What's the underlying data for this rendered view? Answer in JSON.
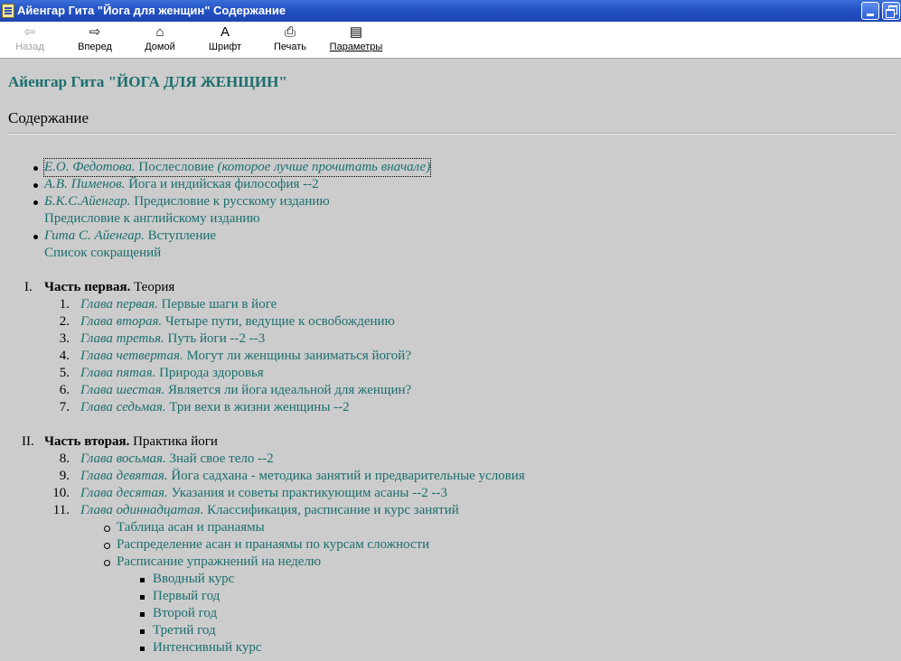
{
  "window": {
    "title": "Айенгар Гита \"Йога для женщин\" Содержание"
  },
  "toolbar": [
    {
      "label": "Назад",
      "icon": "back-arrow-icon",
      "glyph": "⇦",
      "disabled": true
    },
    {
      "label": "Вперед",
      "icon": "forward-arrow-icon",
      "glyph": "⇨",
      "disabled": false
    },
    {
      "label": "Домой",
      "icon": "home-icon",
      "glyph": "⌂",
      "disabled": false
    },
    {
      "label": "Шрифт",
      "icon": "font-icon",
      "glyph": "A",
      "disabled": false
    },
    {
      "label": "Печать",
      "icon": "printer-icon",
      "glyph": "⎙",
      "disabled": false
    },
    {
      "label": "Параметры",
      "icon": "options-icon",
      "glyph": "▤",
      "disabled": false
    }
  ],
  "page": {
    "heading": "Айенгар Гита \"ЙОГА ДЛЯ ЖЕНЩИН\"",
    "subheading": "Содержание"
  },
  "intro": [
    {
      "author": "Е.О. Федотова.",
      "title": " Послесловие",
      "note": " (которое лучше прочитать вначале)",
      "focused": true
    },
    {
      "author": "А.В. Пименов.",
      "title": " Йога и индийская философия --2"
    },
    {
      "author": "Б.К.С.Айенгар.",
      "title": " Предисловие к русскому изданию"
    },
    {
      "plain": "Предисловие к английскому изданию"
    },
    {
      "author": "Гита С. Айенгар.",
      "title": " Вступление"
    },
    {
      "plain": "Список сокращений"
    }
  ],
  "part1": {
    "marker": "I.",
    "name": "Часть первая.",
    "title": " Теория",
    "chapters": [
      {
        "n": "1.",
        "chapter": "Глава первая.",
        "title": " Первые шаги в йоге"
      },
      {
        "n": "2.",
        "chapter": "Глава вторая.",
        "title": " Четыре пути, ведущие к освобождению"
      },
      {
        "n": "3.",
        "chapter": "Глава третья.",
        "title": " Путь йоги --2 --3"
      },
      {
        "n": "4.",
        "chapter": "Глава четвертая.",
        "title": " Могут ли женщины заниматься йогой?"
      },
      {
        "n": "5.",
        "chapter": "Глава пятая.",
        "title": " Природа здоровья"
      },
      {
        "n": "6.",
        "chapter": "Глава шестая.",
        "title": " Является ли йога идеальной для женщин?"
      },
      {
        "n": "7.",
        "chapter": "Глава седьмая.",
        "title": " Три вехи в жизни женщины --2"
      }
    ]
  },
  "part2": {
    "marker": "II.",
    "name": "Часть вторая.",
    "title": " Практика йоги",
    "chapters": [
      {
        "n": "8.",
        "chapter": "Глава восьмая.",
        "title": " Знай свое тело --2"
      },
      {
        "n": "9.",
        "chapter": "Глава девятая.",
        "title": " Йога садхана - методика занятий и предварительные условия"
      },
      {
        "n": "10.",
        "chapter": "Глава десятая.",
        "title": " Указания и советы практикующим асаны --2 --3"
      },
      {
        "n": "11.",
        "chapter": "Глава одиннадцатая.",
        "title": " Классификация, расписание и курс занятий"
      }
    ],
    "subitems": [
      "Таблица асан и пранаямы",
      "Распределение асан и пранаямы по курсам сложности",
      "Расписание упражнений на неделю"
    ],
    "courses": [
      "Вводный курс",
      "Первый год",
      "Второй год",
      "Третий год",
      "Интенсивный курс"
    ]
  }
}
